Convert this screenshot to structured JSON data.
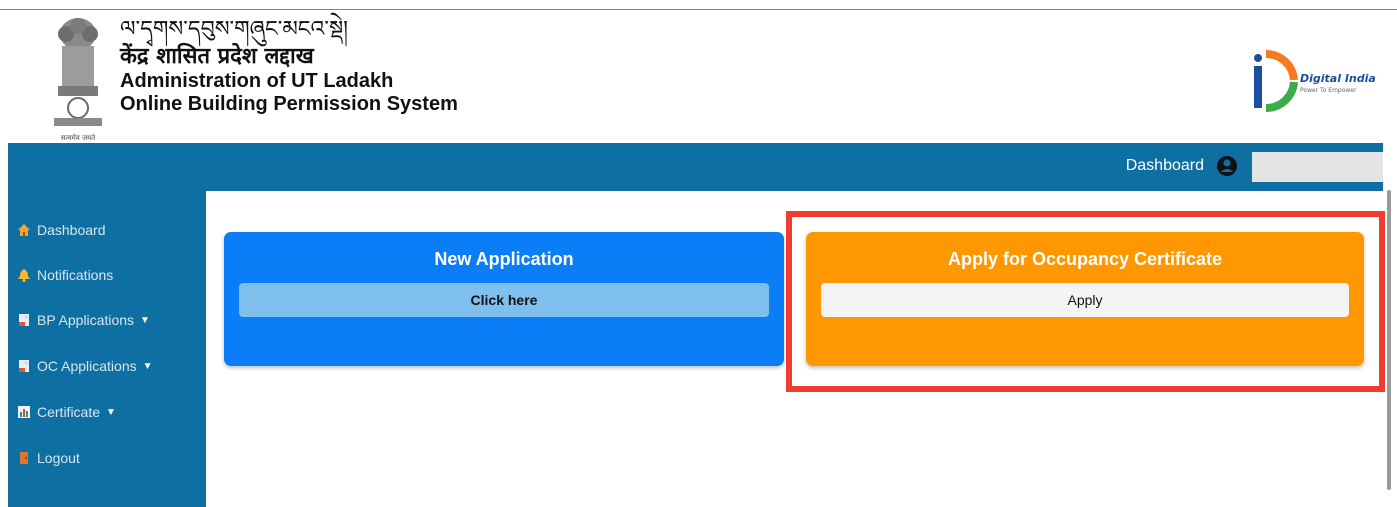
{
  "header": {
    "title_tibetan": "ལ་དྭགས་དབུས་གཞུང་མངའ་སྡེ།",
    "title_hindi": "केंद्र शासित प्रदेश लद्दाख",
    "title_en": "Administration of UT Ladakh",
    "subtitle_en": "Online Building Permission System",
    "emblem_motto": "सत्यमेव जयते",
    "digital_india_title": "Digital India",
    "digital_india_tagline": "Power To Empower"
  },
  "navbar": {
    "dashboard_label": "Dashboard",
    "user_name": ""
  },
  "sidebar": {
    "items": [
      {
        "label": "Dashboard",
        "icon": "home-icon",
        "caret": false
      },
      {
        "label": "Notifications",
        "icon": "bell-icon",
        "caret": false
      },
      {
        "label": "BP Applications",
        "icon": "file-icon",
        "caret": true
      },
      {
        "label": "OC Applications",
        "icon": "file-icon",
        "caret": true
      },
      {
        "label": "Certificate",
        "icon": "chart-icon",
        "caret": true
      },
      {
        "label": "Logout",
        "icon": "door-icon",
        "caret": false
      }
    ]
  },
  "cards": {
    "new_application": {
      "title": "New Application",
      "button_label": "Click here",
      "color": "#0a7df7"
    },
    "occupancy": {
      "title": "Apply for Occupancy Certificate",
      "button_label": "Apply",
      "color": "#ff9800"
    }
  },
  "colors": {
    "brand": "#0e6fa3",
    "highlight": "#f23b30"
  }
}
